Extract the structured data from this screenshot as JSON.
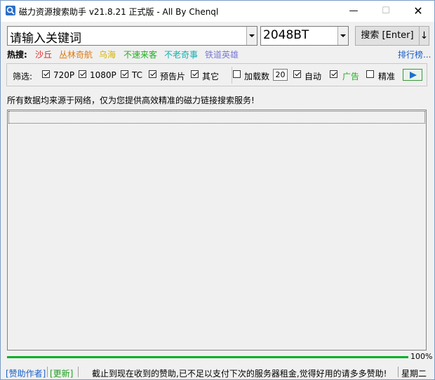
{
  "window": {
    "title": "磁力资源搜索助手 v21.8.21 正式版 - All By Chenql",
    "minimize": "—",
    "maximize": "☐",
    "close": "✕"
  },
  "search": {
    "keyword_placeholder": "请输入关键词",
    "engine": "2048BT",
    "search_button": "搜索 [Enter]",
    "extra_button": "↓"
  },
  "hot": {
    "label": "热搜:",
    "items": [
      {
        "text": "沙丘",
        "color": "#e02020"
      },
      {
        "text": "丛林奇航",
        "color": "#e07a10"
      },
      {
        "text": "乌海",
        "color": "#d6b400"
      },
      {
        "text": "不速来客",
        "color": "#20b020"
      },
      {
        "text": "不老奇事",
        "color": "#10b0b0"
      },
      {
        "text": "铁道英雄",
        "color": "#7a7ad8"
      }
    ],
    "rank_link": "排行榜..."
  },
  "filters": {
    "label": "筛选:",
    "options": [
      {
        "text": "720P",
        "checked": true
      },
      {
        "text": "1080P",
        "checked": true
      },
      {
        "text": "TC",
        "checked": true
      },
      {
        "text": "预告片",
        "checked": true
      },
      {
        "text": "其它",
        "checked": true
      }
    ],
    "load_count_label": "加载数",
    "load_count_checked": false,
    "load_count_value": "20",
    "auto_label": "自动",
    "auto_checked": true,
    "ads_label": "广告",
    "ads_checked": true,
    "ads_color": "#20b020",
    "exact_label": "精准",
    "exact_checked": false
  },
  "notice": "所有数据均来源于网络，仅为您提供高效精准的磁力链接搜索服务!",
  "progress": {
    "percent_text": "100%",
    "value": 1.0,
    "color": "#06b025"
  },
  "status": {
    "sponsor_link": "[赞助作者]",
    "update_link": "[更新]",
    "message": "截止到现在收到的赞助,已不足以支付下次的服务器租金,觉得好用的请多多赞助!",
    "weekday": "星期二"
  }
}
